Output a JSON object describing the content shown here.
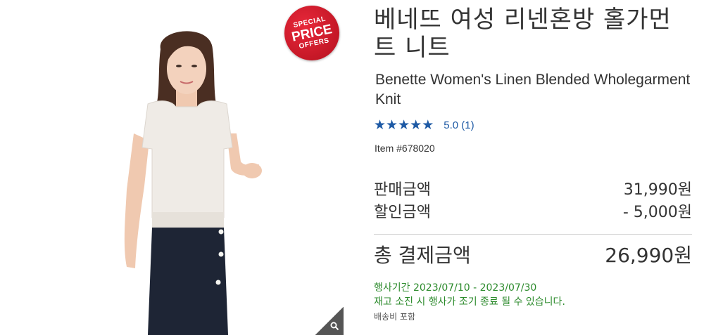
{
  "product": {
    "title_ko": "베네뜨 여성 리넨혼방 홀가먼트 니트",
    "title_en": "Benette Women's Linen Blended Wholegarment Knit",
    "rating_text": "5.0  (1)",
    "rating_value": 5.0,
    "item_number": "Item #678020"
  },
  "badge": {
    "line1": "SPECIAL",
    "line2": "PRICE",
    "line3": "OFFERS"
  },
  "pricing": {
    "sale_price_label": "판매금액",
    "sale_price_value": "31,990원",
    "discount_label": "할인금액",
    "discount_value": "- 5,000원",
    "total_label": "총 결제금액",
    "total_value": "26,990원"
  },
  "promo": {
    "period": "행사기간 2023/07/10 - 2023/07/30",
    "notice": "재고 소진 시 행사가 조기 종료 될 수 있습니다.",
    "shipping": "배송비 포함"
  },
  "colors": {
    "accent_blue": "#1e5aa5",
    "promo_green": "#2b8a2b",
    "badge_red": "#d21a2b"
  },
  "icons": {
    "zoom": "magnifier-icon",
    "star": "star-icon"
  }
}
